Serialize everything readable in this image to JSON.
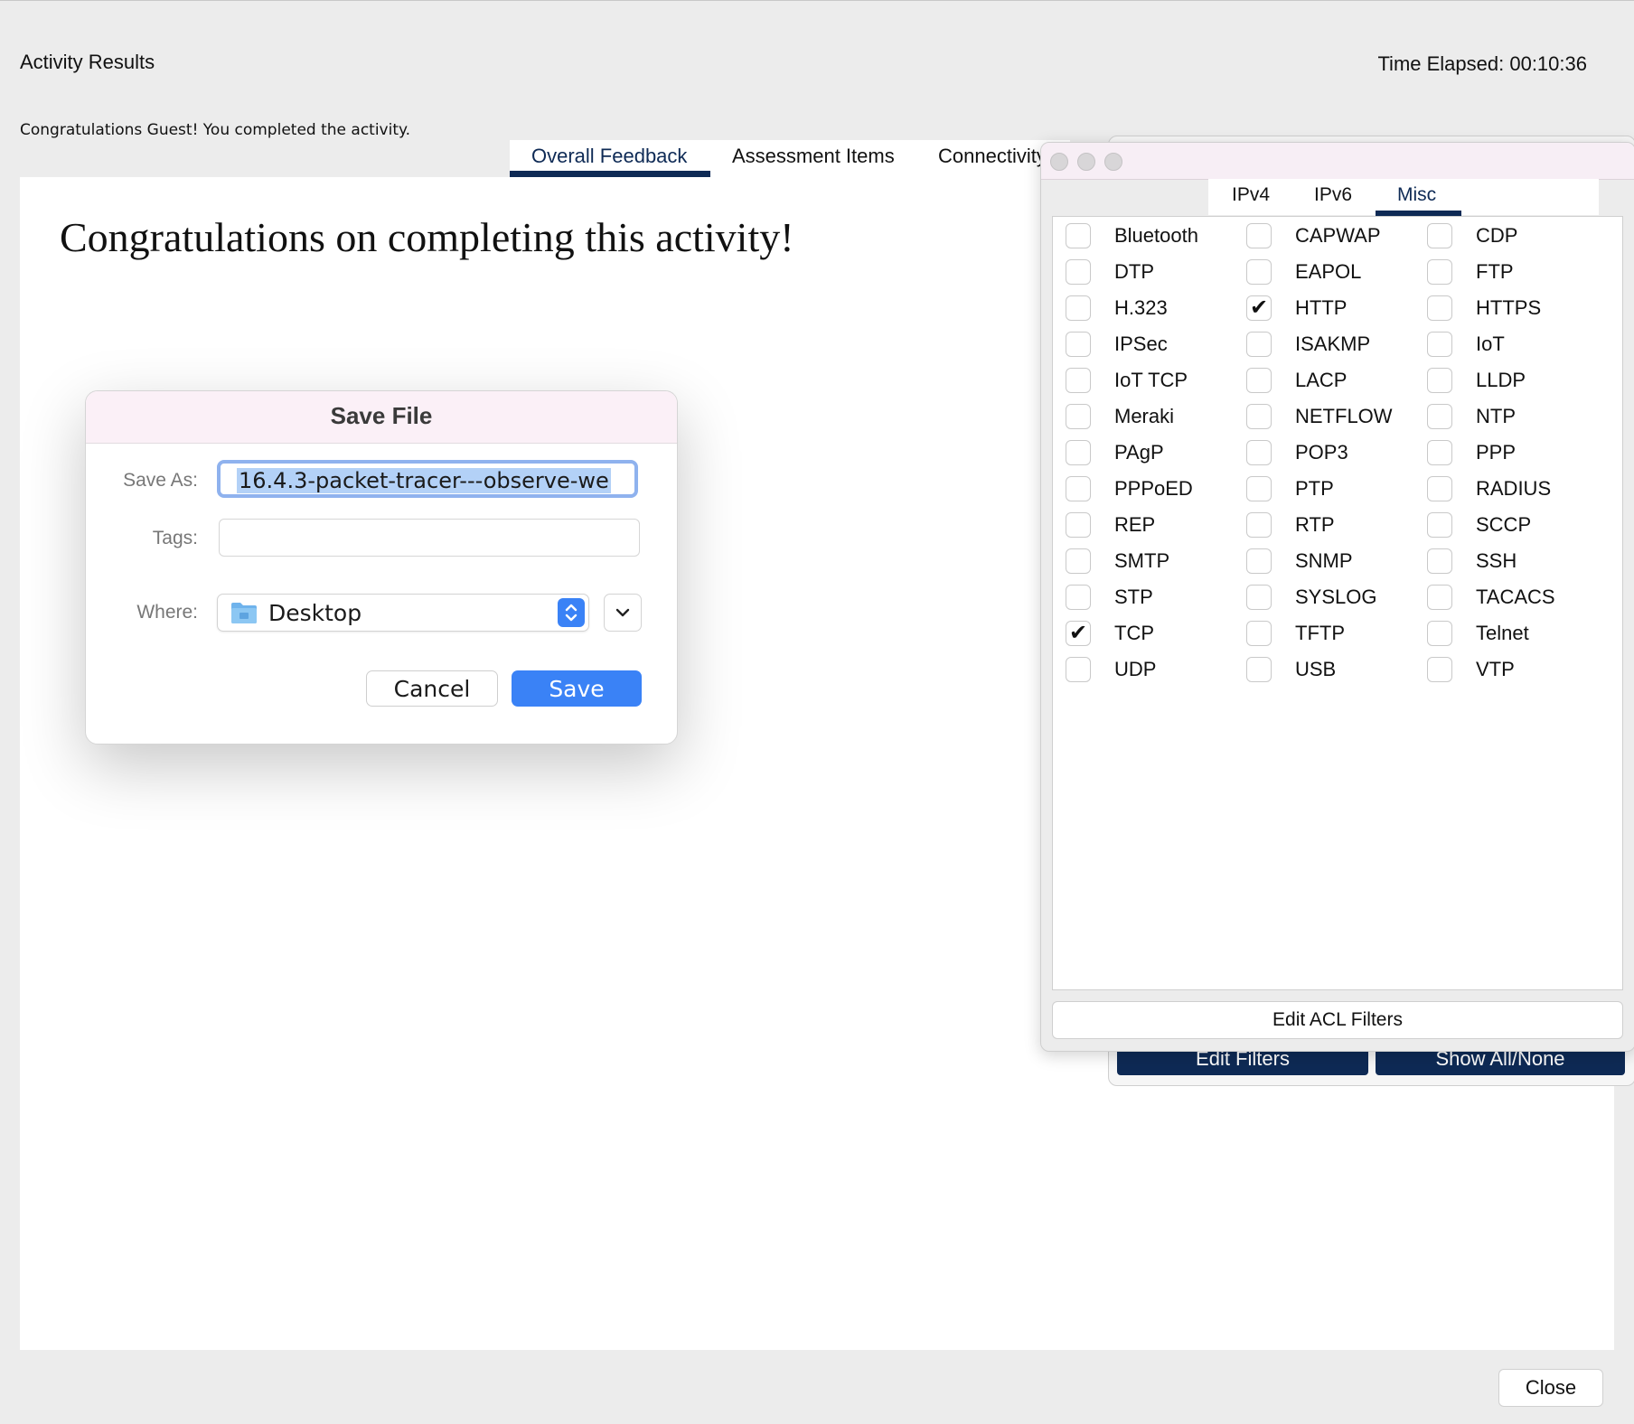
{
  "header": {
    "title": "Activity Results",
    "time_elapsed": "Time Elapsed: 00:10:36",
    "message": "Congratulations Guest! You completed the activity."
  },
  "tabs": [
    {
      "label": "Overall Feedback",
      "active": true
    },
    {
      "label": "Assessment Items",
      "active": false
    },
    {
      "label": "Connectivity",
      "active": false
    }
  ],
  "content": {
    "headline": "Congratulations on completing this activity!"
  },
  "footer": {
    "close_label": "Close"
  },
  "back_window": {
    "edit_filters_label": "Edit Filters",
    "show_all_none_label": "Show All/None"
  },
  "filter_window": {
    "tabs": [
      {
        "label": "IPv4",
        "active": false
      },
      {
        "label": "IPv6",
        "active": false
      },
      {
        "label": "Misc",
        "active": true
      }
    ],
    "protocols": [
      {
        "label": "Bluetooth",
        "checked": false
      },
      {
        "label": "CAPWAP",
        "checked": false
      },
      {
        "label": "CDP",
        "checked": false
      },
      {
        "label": "DTP",
        "checked": false
      },
      {
        "label": "EAPOL",
        "checked": false
      },
      {
        "label": "FTP",
        "checked": false
      },
      {
        "label": "H.323",
        "checked": false
      },
      {
        "label": "HTTP",
        "checked": true
      },
      {
        "label": "HTTPS",
        "checked": false
      },
      {
        "label": "IPSec",
        "checked": false
      },
      {
        "label": "ISAKMP",
        "checked": false
      },
      {
        "label": "IoT",
        "checked": false
      },
      {
        "label": "IoT TCP",
        "checked": false
      },
      {
        "label": "LACP",
        "checked": false
      },
      {
        "label": "LLDP",
        "checked": false
      },
      {
        "label": "Meraki",
        "checked": false
      },
      {
        "label": "NETFLOW",
        "checked": false
      },
      {
        "label": "NTP",
        "checked": false
      },
      {
        "label": "PAgP",
        "checked": false
      },
      {
        "label": "POP3",
        "checked": false
      },
      {
        "label": "PPP",
        "checked": false
      },
      {
        "label": "PPPoED",
        "checked": false
      },
      {
        "label": "PTP",
        "checked": false
      },
      {
        "label": "RADIUS",
        "checked": false
      },
      {
        "label": "REP",
        "checked": false
      },
      {
        "label": "RTP",
        "checked": false
      },
      {
        "label": "SCCP",
        "checked": false
      },
      {
        "label": "SMTP",
        "checked": false
      },
      {
        "label": "SNMP",
        "checked": false
      },
      {
        "label": "SSH",
        "checked": false
      },
      {
        "label": "STP",
        "checked": false
      },
      {
        "label": "SYSLOG",
        "checked": false
      },
      {
        "label": "TACACS",
        "checked": false
      },
      {
        "label": "TCP",
        "checked": true
      },
      {
        "label": "TFTP",
        "checked": false
      },
      {
        "label": "Telnet",
        "checked": false
      },
      {
        "label": "UDP",
        "checked": false
      },
      {
        "label": "USB",
        "checked": false
      },
      {
        "label": "VTP",
        "checked": false
      }
    ],
    "edit_acl_label": "Edit ACL Filters"
  },
  "save_dialog": {
    "title": "Save File",
    "save_as_label": "Save As:",
    "save_as_value": "16.4.3-packet-tracer---observe-we",
    "tags_label": "Tags:",
    "tags_value": "",
    "where_label": "Where:",
    "where_value": "Desktop",
    "cancel_label": "Cancel",
    "save_label": "Save"
  },
  "colors": {
    "accent_navy": "#0e2a55",
    "save_blue": "#3a82f6",
    "selection": "#b3d1f7",
    "focus_ring": "#8fb2ee"
  }
}
